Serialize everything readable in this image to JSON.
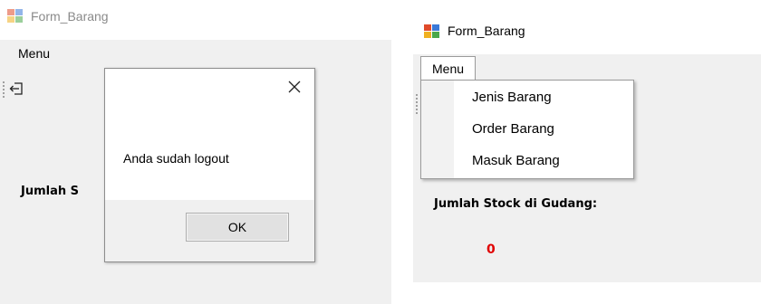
{
  "window_left": {
    "title": "Form_Barang",
    "menu_label": "Menu",
    "label_partial": "Jumlah S",
    "icons": {
      "app": "form-app-icon",
      "logout": "logout-icon"
    }
  },
  "dialog": {
    "message": "Anda sudah logout",
    "ok_label": "OK",
    "close_icon": "close-icon"
  },
  "window_right": {
    "title": "Form_Barang",
    "menu_label": "Menu",
    "dropdown_items": [
      "Jenis Barang",
      "Order Barang",
      "Masuk Barang"
    ],
    "stock_label": "Jumlah Stock di Gudang:",
    "stock_value": "0",
    "stock_value_color": "#e00000"
  }
}
